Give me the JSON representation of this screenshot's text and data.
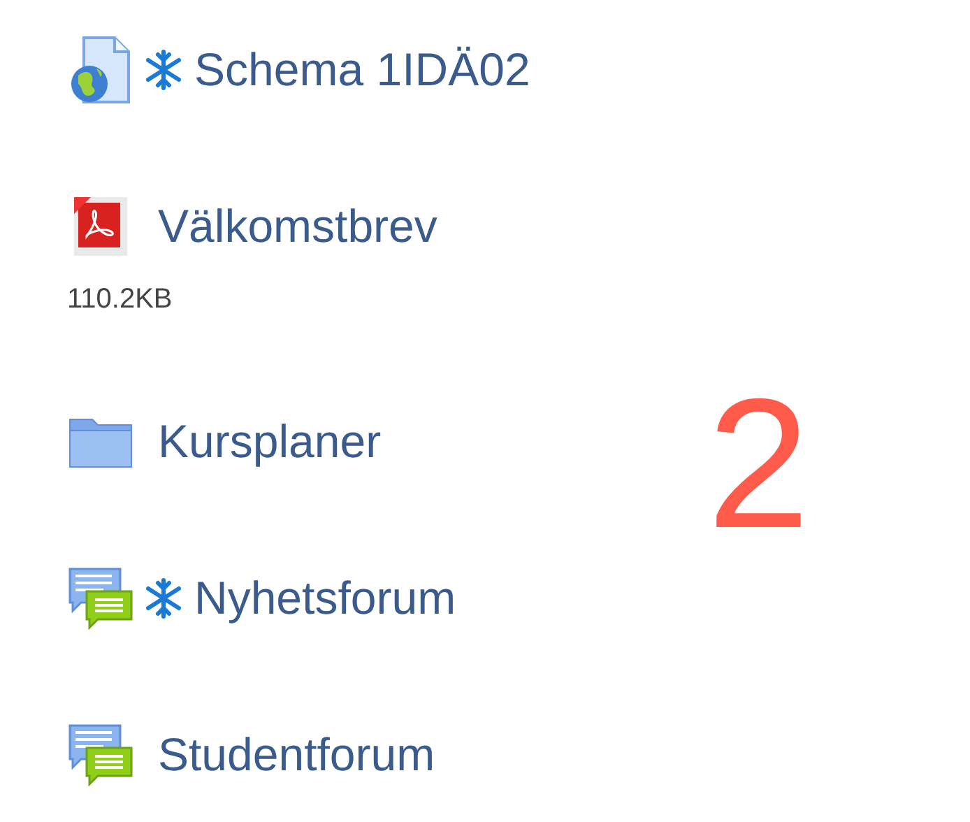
{
  "items": [
    {
      "kind": "url",
      "snowflake": true,
      "title": "Schema 1IDÄ02"
    },
    {
      "kind": "pdf",
      "snowflake": false,
      "title": "Välkomstbrev",
      "description": "110.2KB"
    },
    {
      "kind": "folder",
      "snowflake": false,
      "title": "Kursplaner"
    },
    {
      "kind": "forum",
      "snowflake": true,
      "title": "Nyhetsforum"
    },
    {
      "kind": "forum",
      "snowflake": false,
      "title": "Studentforum"
    }
  ],
  "annotation": "2"
}
